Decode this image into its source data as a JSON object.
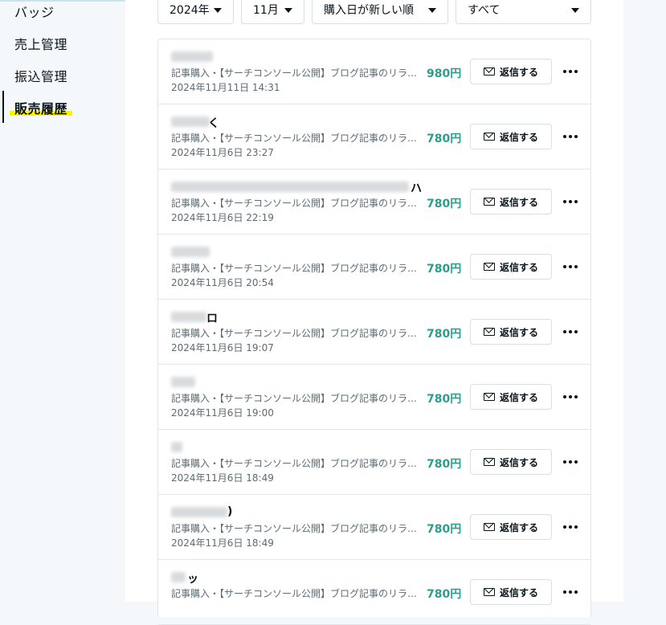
{
  "sidebar": {
    "items": [
      {
        "label": "バッジ",
        "active": false
      },
      {
        "label": "売上管理",
        "active": false
      },
      {
        "label": "振込管理",
        "active": false
      },
      {
        "label": "販売履歴",
        "active": true
      }
    ]
  },
  "filters": {
    "year": "2024年",
    "month": "11月",
    "sort": "購入日が新しい順",
    "type": "すべて"
  },
  "sales": {
    "reply_label": "返信する",
    "rows": [
      {
        "buyer": "",
        "description": "記事購入・【サーチコンソール公開】ブログ記事のリライト",
        "price": "980円",
        "date": "2024年11月11日 14:31"
      },
      {
        "buyer": "く",
        "description": "記事購入・【サーチコンソール公開】ブログ記事のリライト",
        "price": "780円",
        "date": "2024年11月6日 23:27"
      },
      {
        "buyer": "ハ",
        "description": "記事購入・【サーチコンソール公開】ブログ記事のリライト",
        "price": "780円",
        "date": "2024年11月6日 22:19"
      },
      {
        "buyer": "",
        "description": "記事購入・【サーチコンソール公開】ブログ記事のリライト",
        "price": "780円",
        "date": "2024年11月6日 20:54"
      },
      {
        "buyer": "ロ",
        "description": "記事購入・【サーチコンソール公開】ブログ記事のリライト",
        "price": "780円",
        "date": "2024年11月6日 19:07"
      },
      {
        "buyer": "",
        "description": "記事購入・【サーチコンソール公開】ブログ記事のリライト",
        "price": "780円",
        "date": "2024年11月6日 19:00"
      },
      {
        "buyer": "",
        "description": "記事購入・【サーチコンソール公開】ブログ記事のリライト",
        "price": "780円",
        "date": "2024年11月6日 18:49"
      },
      {
        "buyer": ")",
        "description": "記事購入・【サーチコンソール公開】ブログ記事のリライト",
        "price": "780円",
        "date": "2024年11月6日 18:49"
      },
      {
        "buyer": "ッ",
        "description": "記事購入・【サーチコンソール公開】ブログ記事のリライト",
        "price": "780円",
        "date": ""
      }
    ]
  }
}
